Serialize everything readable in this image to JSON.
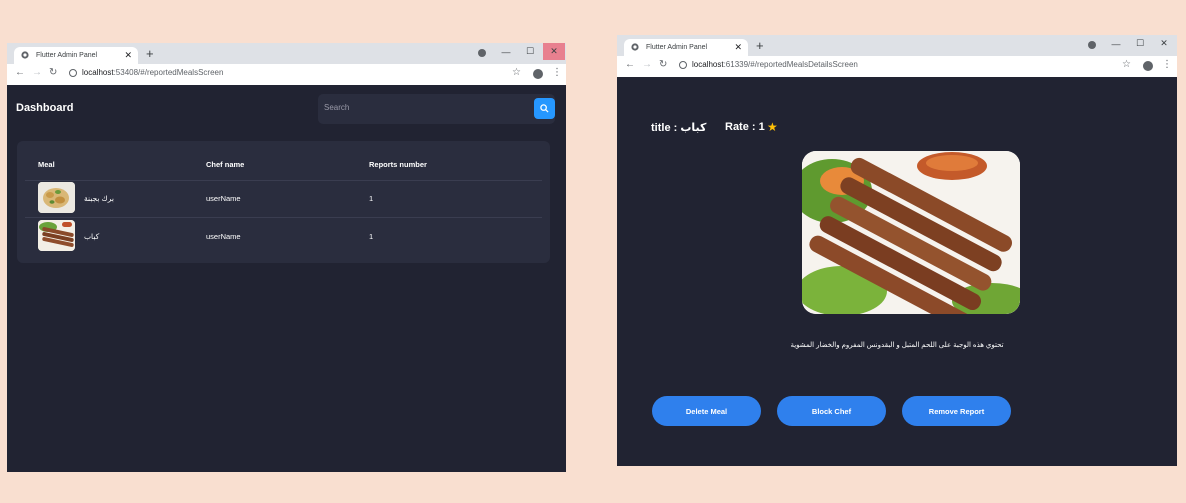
{
  "left_window": {
    "tab_title": "Flutter Admin Panel",
    "url_host": "localhost",
    "url_path": ":53408/#/reportedMealsScreen",
    "app": {
      "title": "Dashboard",
      "search": {
        "placeholder": "Search"
      },
      "table": {
        "headers": [
          "Meal",
          "Chef name",
          "Reports number"
        ],
        "rows": [
          {
            "meal": "برك بجبنة",
            "chef": "userName",
            "reports": "1"
          },
          {
            "meal": "كباب",
            "chef": "userName",
            "reports": "1"
          }
        ]
      }
    }
  },
  "right_window": {
    "tab_title": "Flutter Admin Panel",
    "url_host": "localhost",
    "url_path": ":61339/#/reportedMealsDetailsScreen",
    "app": {
      "title_line": "title : كباب",
      "rate_line": "Rate : 1",
      "description": "تحتوي هذه الوجبة على اللحم المتبل و البقدونس المفروم والخضار المشوية",
      "buttons": {
        "delete": "Delete Meal",
        "block": "Block Chef",
        "remove": "Remove Report"
      }
    }
  },
  "colors": {
    "background": "#f9dfd0",
    "app_bg": "#212332",
    "card_bg": "#2a2d3e",
    "accent": "#2697ff",
    "button": "#2f80ed",
    "star": "#ffc107",
    "close_hover": "#e8808f"
  },
  "icons": [
    "globe-icon",
    "close-icon",
    "plus-icon",
    "back-icon",
    "forward-icon",
    "reload-icon",
    "info-icon",
    "star-icon",
    "profile-icon",
    "menu-dots-icon",
    "search-icon",
    "minimize-icon",
    "maximize-icon"
  ]
}
